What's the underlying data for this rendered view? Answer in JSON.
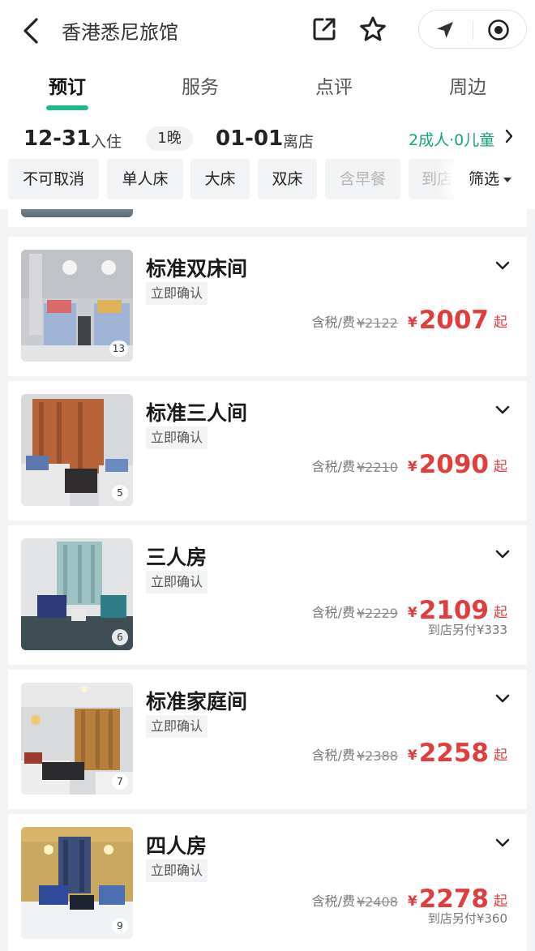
{
  "header": {
    "title": "香港悉尼旅馆"
  },
  "tabs": [
    {
      "label": "预订",
      "active": true
    },
    {
      "label": "服务",
      "active": false
    },
    {
      "label": "点评",
      "active": false
    },
    {
      "label": "周边",
      "active": false
    }
  ],
  "booking": {
    "checkin_date": "12-31",
    "checkin_label": "入住",
    "nights": "1晚",
    "checkout_date": "01-01",
    "checkout_label": "离店",
    "guests": "2成人·0儿童"
  },
  "filters": {
    "chips": [
      "不可取消",
      "单人床",
      "大床",
      "双床",
      "含早餐",
      "到店"
    ],
    "filter_label": "筛选"
  },
  "rooms": [
    {
      "name": "标准双床间",
      "tag": "立即确认",
      "photo_count": "13",
      "tax_label": "含税/费",
      "original_price": "¥2122",
      "currency": "¥",
      "price": "2007",
      "suffix": "起",
      "extra": ""
    },
    {
      "name": "标准三人间",
      "tag": "立即确认",
      "photo_count": "5",
      "tax_label": "含税/费",
      "original_price": "¥2210",
      "currency": "¥",
      "price": "2090",
      "suffix": "起",
      "extra": ""
    },
    {
      "name": "三人房",
      "tag": "立即确认",
      "photo_count": "6",
      "tax_label": "含税/费",
      "original_price": "¥2229",
      "currency": "¥",
      "price": "2109",
      "suffix": "起",
      "extra": "到店另付¥333"
    },
    {
      "name": "标准家庭间",
      "tag": "立即确认",
      "photo_count": "7",
      "tax_label": "含税/费",
      "original_price": "¥2388",
      "currency": "¥",
      "price": "2258",
      "suffix": "起",
      "extra": ""
    },
    {
      "name": "四人房",
      "tag": "立即确认",
      "photo_count": "9",
      "tax_label": "含税/费",
      "original_price": "¥2408",
      "currency": "¥",
      "price": "2278",
      "suffix": "起",
      "extra": "到店另付¥360"
    }
  ],
  "colors": {
    "accent_green": "#1fb88a",
    "guests_green": "#17a673",
    "price_red": "#e23d3d"
  }
}
